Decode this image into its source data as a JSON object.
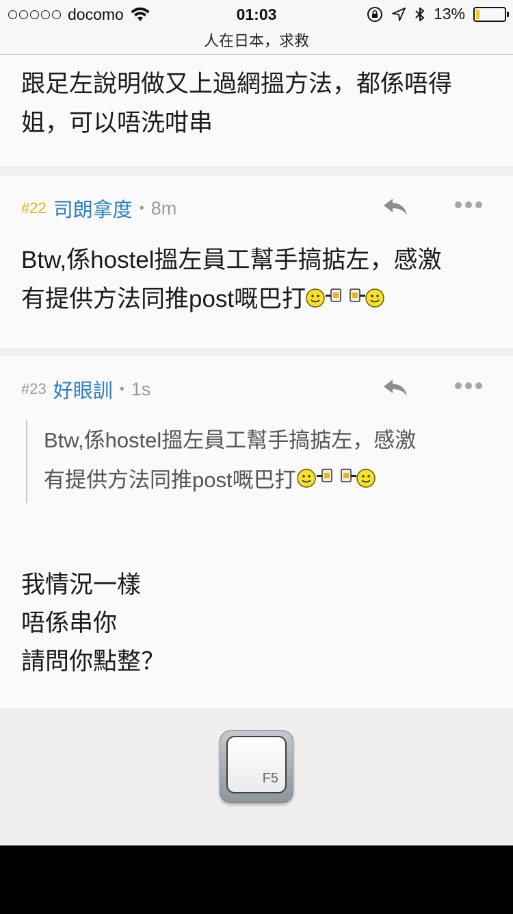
{
  "status_bar": {
    "carrier": "docomo",
    "time": "01:03",
    "battery_percent": "13%",
    "battery_level": 0.13
  },
  "nav": {
    "title": "人在日本，求救"
  },
  "posts": [
    {
      "body_lines": [
        "跟足左說明做又上過網搵方法，都係唔得",
        "姐，可以唔洗咁串"
      ]
    },
    {
      "number": "#22",
      "user": "司朗拿度",
      "time": "8m",
      "body_lines": [
        "Btw,係hostel搵左員工幫手搞掂左，感激",
        "有提供方法同推post嘅巴打"
      ]
    },
    {
      "number": "#23",
      "user": "好眼訓",
      "time": "1s",
      "quote_lines": [
        "Btw,係hostel搵左員工幫手搞掂左，感激",
        "有提供方法同推post嘅巴打"
      ],
      "body_lines": [
        "我情況一樣",
        "唔係串你",
        "請問你點整？"
      ]
    }
  ],
  "separator": "•",
  "refresh_key": {
    "label": "F5"
  },
  "icons": {
    "reply": "reply-arrow-icon",
    "more": "more-dots-icon",
    "emoticon": "cheers-emoticon-icon",
    "wifi": "wifi-icon",
    "location": "location-arrow-icon",
    "bluetooth": "bluetooth-icon",
    "rotation_lock": "rotation-lock-icon"
  },
  "colors": {
    "post_number_highlight": "#e6b21a",
    "username": "#2f7eb8",
    "battery_fill": "#f4c51d"
  }
}
